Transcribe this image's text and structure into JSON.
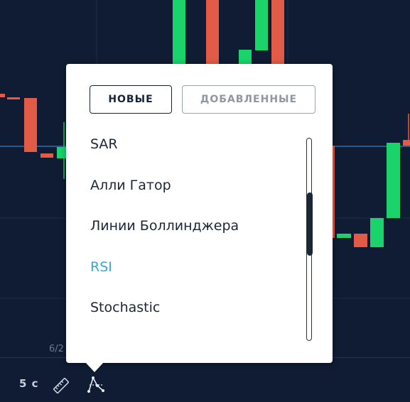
{
  "chart": {
    "date_label": "6/2",
    "colors": {
      "up": "#1ad36b",
      "down": "#e25b47",
      "background": "#0f1c33",
      "line": "#2d6fb0"
    }
  },
  "toolbar": {
    "timeframe": "5 c",
    "icons": [
      "ruler-icon",
      "indicators-icon"
    ]
  },
  "popup": {
    "tabs": [
      {
        "label": "НОВЫЕ",
        "selected": true
      },
      {
        "label": "ДОБАВЛЕННЫЕ",
        "selected": false
      }
    ],
    "items": [
      {
        "label": "SAR"
      },
      {
        "label": "Алли Гатор"
      },
      {
        "label": "Линии Боллинджера"
      },
      {
        "label": "RSI",
        "active": true
      },
      {
        "label": "Stochastic"
      }
    ],
    "accent_color": "#32a9d6"
  }
}
